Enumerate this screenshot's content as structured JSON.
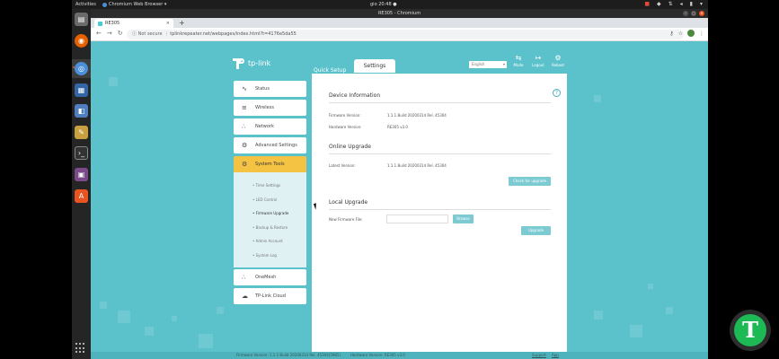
{
  "topbar": {
    "activities": "Activities",
    "app_name": "Chromium Web Browser ▾",
    "clock": "gio 20:48 ●"
  },
  "window": {
    "title": "RE305 - Chromium"
  },
  "browser": {
    "tab_title": "RE305",
    "tab_close": "×",
    "new_tab": "+",
    "not_secure": "ⓘ Not secure",
    "url": "tplinkrepeater.net/webpages/index.html?t=4176e5da55"
  },
  "router": {
    "brand": "tp-link",
    "tabs": {
      "quick_setup": "Quick Setup",
      "settings": "Settings"
    },
    "language": "English",
    "top_icons": [
      {
        "label": "Mode",
        "icon": "mode-icon",
        "glyph": "⇆"
      },
      {
        "label": "Logout",
        "icon": "logout-icon",
        "glyph": "↦"
      },
      {
        "label": "Reboot",
        "icon": "reboot-icon",
        "glyph": "⚙"
      }
    ],
    "menu": [
      {
        "label": "Status",
        "glyph": "∿"
      },
      {
        "label": "Wireless",
        "glyph": "≡"
      },
      {
        "label": "Network",
        "glyph": "∴"
      },
      {
        "label": "Advanced Settings",
        "glyph": "⚙"
      },
      {
        "label": "System Tools",
        "glyph": "⚙"
      }
    ],
    "submenu": [
      "Time Settings",
      "LED Control",
      "Firmware Upgrade",
      "Backup & Restore",
      "Admin Account",
      "System Log"
    ],
    "menu_bottom": [
      {
        "label": "OneMesh",
        "glyph": "∴"
      },
      {
        "label": "TP-Link Cloud",
        "glyph": "☁"
      }
    ],
    "device_info": {
      "title": "Device Information",
      "firmware_label": "Firmware Version:",
      "firmware_value": "1.1.1 Build 20200314 Rel. 45304",
      "hardware_label": "Hardware Version:",
      "hardware_value": "RE305 v3.0"
    },
    "online_upgrade": {
      "title": "Online Upgrade",
      "latest_label": "Latest Version:",
      "latest_value": "1.1.1 Build 20200314 Rel. 45304",
      "check_button": "Check for upgrade"
    },
    "local_upgrade": {
      "title": "Local Upgrade",
      "file_label": "New Firmware File:",
      "browse_button": "Browse",
      "upgrade_button": "Upgrade"
    },
    "footer": {
      "firmware": "Firmware Version: 1.1.1 Build 20200314 Rel. 45304(5985)",
      "hardware": "Hardware Version: RE305 v3.0",
      "support": "Support",
      "app": "App"
    }
  },
  "colors": {
    "page_bg": "#5bc2cc",
    "active_menu": "#f5c343",
    "button": "#7ccbd3"
  }
}
